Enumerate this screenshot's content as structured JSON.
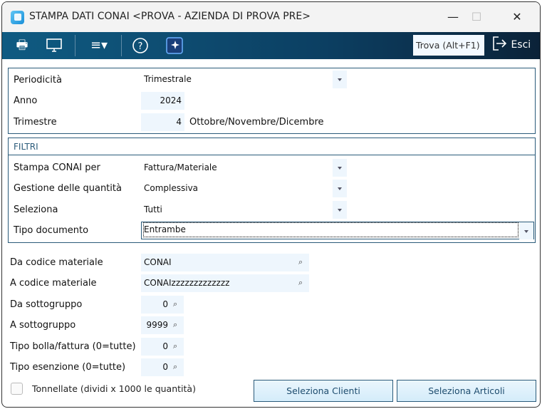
{
  "window": {
    "title": "STAMPA DATI CONAI <PROVA - AZIENDA DI PROVA PRE>",
    "minimize": "—",
    "maximize": "☐",
    "close": "✕"
  },
  "toolbar": {
    "search_placeholder": "Trova (Alt+F1)",
    "exit_label": "Esci"
  },
  "period": {
    "periodicita": {
      "label": "Periodicità",
      "value": "Trimestrale"
    },
    "anno": {
      "label": "Anno",
      "value": "2024"
    },
    "trimestre": {
      "label": "Trimestre",
      "value": "4",
      "description": "Ottobre/Novembre/Dicembre"
    }
  },
  "filters": {
    "title": "FILTRI",
    "stampa": {
      "label": "Stampa CONAI per",
      "value": "Fattura/Materiale"
    },
    "gestione": {
      "label": "Gestione delle quantità",
      "value": "Complessiva"
    },
    "seleziona": {
      "label": "Seleziona",
      "value": "Tutti"
    },
    "tipo_doc": {
      "label": "Tipo documento",
      "value": "Entrambe"
    }
  },
  "range": {
    "da_codice": {
      "label": "Da codice materiale",
      "value": "CONAI"
    },
    "a_codice": {
      "label": "A codice materiale",
      "value": "CONAIzzzzzzzzzzzzz"
    },
    "da_sotto": {
      "label": "Da sottogruppo",
      "value": "0"
    },
    "a_sotto": {
      "label": "A sottogruppo",
      "value": "9999"
    },
    "tipo_bolla": {
      "label": "Tipo bolla/fattura (0=tutte)",
      "value": "0"
    },
    "tipo_esenzione": {
      "label": "Tipo esenzione (0=tutte)",
      "value": "0"
    }
  },
  "tonnellate": {
    "label": "Tonnellate (dividi x 1000 le quantità)",
    "checked": false
  },
  "buttons": {
    "clienti": "Seleziona Clienti",
    "articoli": "Seleziona Articoli"
  }
}
